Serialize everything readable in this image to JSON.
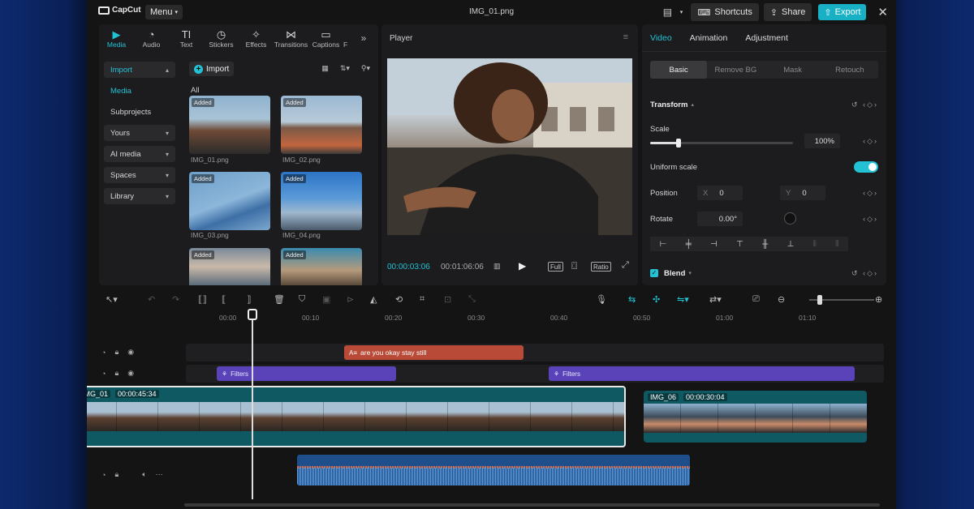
{
  "app": {
    "logo_text": "CapCut",
    "menu_label": "Menu",
    "window_title": "IMG_01.png",
    "shortcuts_label": "Shortcuts",
    "share_label": "Share",
    "export_label": "Export"
  },
  "media_panel": {
    "tabs": [
      {
        "label": "Media",
        "icon": "media-icon"
      },
      {
        "label": "Audio",
        "icon": "audio-icon"
      },
      {
        "label": "Text",
        "icon": "text-icon"
      },
      {
        "label": "Stickers",
        "icon": "stickers-icon"
      },
      {
        "label": "Effects",
        "icon": "effects-icon"
      },
      {
        "label": "Transitions",
        "icon": "transitions-icon"
      },
      {
        "label": "Captions",
        "icon": "captions-icon"
      },
      {
        "label": "F",
        "icon": "filters-icon"
      }
    ],
    "nav": [
      "Import",
      "Media",
      "Subprojects",
      "Yours",
      "AI media",
      "Spaces",
      "Library"
    ],
    "import_button": "Import",
    "all_label": "All",
    "added_badge": "Added",
    "files": [
      "IMG_01.png",
      "IMG_02.png",
      "IMG_03.png",
      "IMG_04.png",
      "",
      ""
    ]
  },
  "player": {
    "title": "Player",
    "current_time": "00:00:03:06",
    "total_time": "00:01:06:06",
    "full_label": "Full",
    "ratio_label": "Ratio"
  },
  "properties": {
    "tabs": [
      "Video",
      "Animation",
      "Adjustment"
    ],
    "subtabs": [
      "Basic",
      "Remove BG",
      "Mask",
      "Retouch"
    ],
    "transform_label": "Transform",
    "scale_label": "Scale",
    "scale_value": "100%",
    "scale_fraction": 0.2,
    "uniform_scale_label": "Uniform scale",
    "uniform_scale_on": true,
    "position_label": "Position",
    "pos_x_label": "X",
    "pos_x_value": "0",
    "pos_y_label": "Y",
    "pos_y_value": "0",
    "rotate_label": "Rotate",
    "rotate_value": "0.00°",
    "blend_label": "Blend"
  },
  "timeline": {
    "ruler": [
      "00:00",
      "00:10",
      "00:20",
      "00:30",
      "00:40",
      "00:50",
      "01:00",
      "01:10"
    ],
    "text_clip": "are you okay stay still",
    "filter_clip_1": "Filters",
    "filter_clip_2": "Filters",
    "main_clip_name": "IMG_01",
    "main_clip_duration": "00:00:45:34",
    "second_clip_name": "IMG_06",
    "second_clip_duration": "00:00:30:04"
  },
  "colors": {
    "accent": "#22c2d4",
    "text_clip": "#b84a37",
    "filter_clip": "#5a42b8",
    "video_clip": "#0f5a62",
    "audio_clip": "#1f4f8a"
  }
}
